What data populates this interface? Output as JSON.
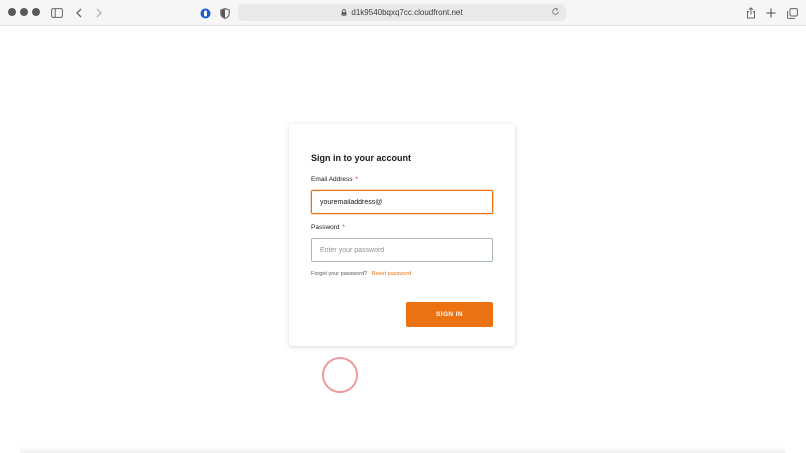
{
  "browser": {
    "url": "d1k9540bqxq7cc.cloudfront.net",
    "icons": [
      "window-controls-icon",
      "sidebar-icon",
      "back-icon",
      "forward-icon",
      "password-manager-icon",
      "privacy-shield-icon",
      "lock-icon",
      "reload-icon",
      "share-icon",
      "new-tab-icon",
      "tab-overview-icon"
    ]
  },
  "login": {
    "title": "Sign in to your account",
    "email_label": "Email Address",
    "email_value": "youremailaddress@",
    "password_label": "Password",
    "password_placeholder": "Enter your password",
    "required_marker": "*",
    "forgot_text": "Forgot your password?",
    "reset_link": "Reset password",
    "signin_label": "SIGN IN"
  },
  "colors": {
    "accent": "#ec7211",
    "required": "#d13212",
    "click_indicator": "#ef9a9a"
  }
}
